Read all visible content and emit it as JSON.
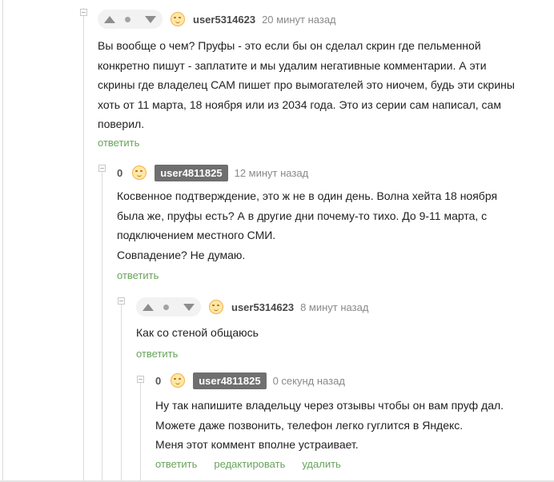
{
  "comments": [
    {
      "username": "user5314623",
      "time": "20 минут назад",
      "text": [
        "Вы вообще о чем? Пруфы - это если бы он сделал скрин где пельменной",
        "конкретно пишут - заплатите и мы удалим негативные комментарии. А эти",
        "скрины где владелец САМ пишет про вымогателей это ниочем, будь эти скрины",
        "хоть от 11 марта, 18 ноября или из 2034 года. Это из серии сам написал, сам",
        "поверил."
      ],
      "reply_label": "ответить"
    },
    {
      "score": "0",
      "username": "user4811825",
      "time": "12 минут назад",
      "text": [
        "Косвенное подтверждение, это ж не в один день. Волна хейта 18 ноября",
        "была же, пруфы есть? А в другие дни почему-то тихо. До 9-11 марта, с",
        "подключением местного СМИ.",
        "Совпадение? Не думаю."
      ],
      "reply_label": "ответить"
    },
    {
      "username": "user5314623",
      "time": "8 минут назад",
      "text": [
        "Как со стеной общаюсь"
      ],
      "reply_label": "ответить"
    },
    {
      "score": "0",
      "username": "user4811825",
      "time": "0 секунд назад",
      "text": [
        "Ну так напишите владельцу через отзывы чтобы он вам пруф дал.",
        "Можете даже позвонить, телефон легко гуглится в Яндекс.",
        "Меня этот коммент вполне устраивает."
      ],
      "reply_label": "ответить",
      "edit_label": "редактировать",
      "delete_label": "удалить"
    }
  ]
}
